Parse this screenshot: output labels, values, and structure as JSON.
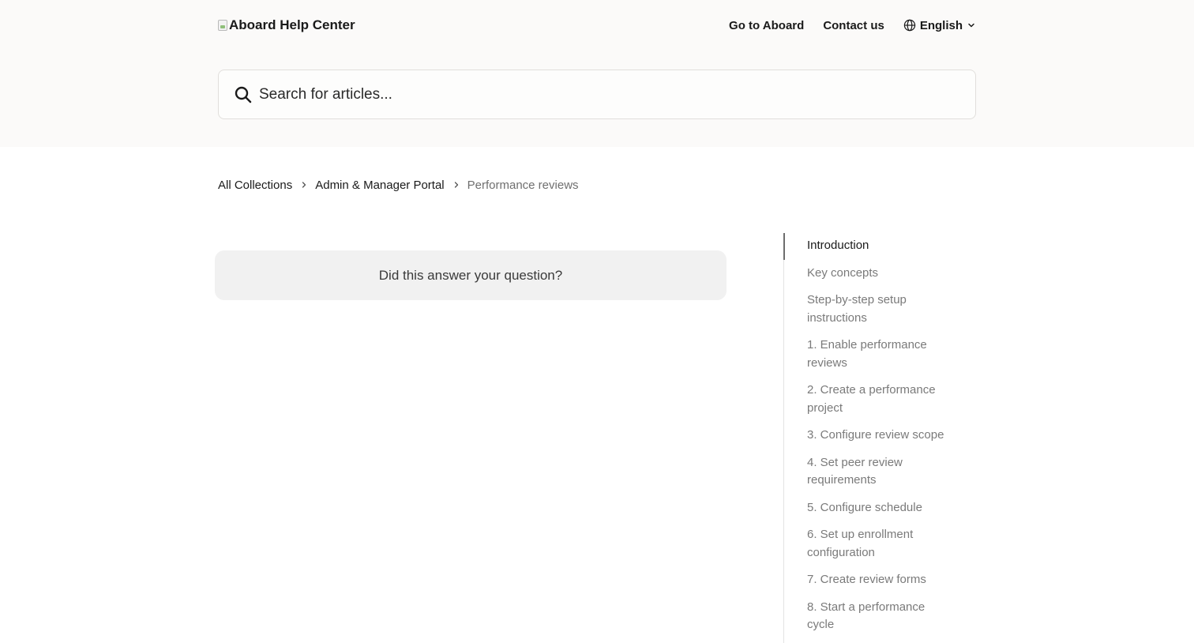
{
  "header": {
    "logo_text": "Aboard Help Center",
    "nav": [
      {
        "label": "Go to Aboard"
      },
      {
        "label": "Contact us"
      }
    ],
    "language": {
      "selected": "English"
    }
  },
  "search": {
    "placeholder": "Search for articles..."
  },
  "breadcrumb": [
    {
      "label": "All Collections"
    },
    {
      "label": "Admin & Manager Portal"
    },
    {
      "label": "Performance reviews"
    }
  ],
  "feedback": {
    "question": "Did this answer your question?"
  },
  "toc": {
    "active_index": 0,
    "items": [
      {
        "label": "Introduction"
      },
      {
        "label": "Key concepts"
      },
      {
        "label": "Step-by-step setup instructions"
      },
      {
        "label": "1. Enable performance reviews"
      },
      {
        "label": "2. Create a performance project"
      },
      {
        "label": "3. Configure review scope"
      },
      {
        "label": "4. Set peer review requirements"
      },
      {
        "label": "5. Configure schedule"
      },
      {
        "label": "6. Set up enrollment configuration"
      },
      {
        "label": "7. Create review forms"
      },
      {
        "label": "8. Start a performance cycle"
      }
    ]
  },
  "colors": {
    "header_bg": "#fbfaf9",
    "text_primary": "#1a1a1a",
    "text_muted": "#7a7a7a",
    "feedback_bg": "#f1f1f1"
  }
}
